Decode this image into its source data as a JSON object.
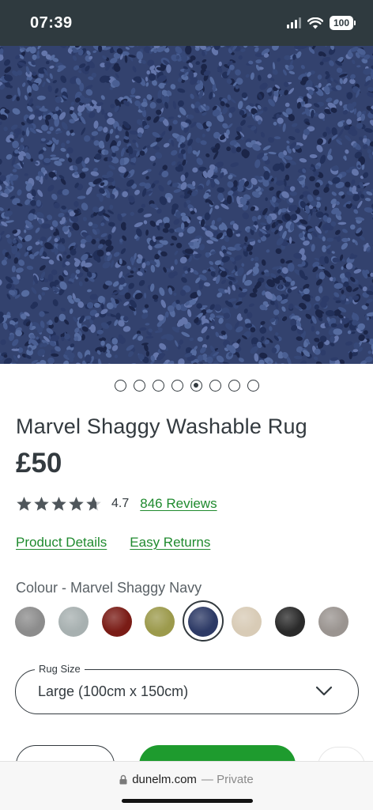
{
  "status": {
    "time": "07:39",
    "battery": "100",
    "icons": [
      "cellular-signal-icon",
      "wifi-icon",
      "battery-icon"
    ]
  },
  "gallery": {
    "image_name": "navy-shaggy-rug-closeup",
    "slides": 8,
    "active_slide": 5
  },
  "product": {
    "title": "Marvel Shaggy Washable Rug",
    "price": "£50",
    "rating": "4.7",
    "rating_stars": 4.7,
    "reviews_label": "846 Reviews",
    "links": {
      "details": "Product Details",
      "returns": "Easy Returns"
    }
  },
  "colour": {
    "label": "Colour - Marvel Shaggy Navy",
    "selected_index": 4,
    "swatches": [
      {
        "name": "grey",
        "color": "#8c8c8c"
      },
      {
        "name": "duck-egg",
        "color": "#a7b0b0"
      },
      {
        "name": "red",
        "color": "#7a1c16"
      },
      {
        "name": "green",
        "color": "#9c9a4c"
      },
      {
        "name": "navy",
        "color": "#2d3a66"
      },
      {
        "name": "cream",
        "color": "#d8cbb6"
      },
      {
        "name": "charcoal",
        "color": "#2a2a2a"
      },
      {
        "name": "silver",
        "color": "#9a9490"
      }
    ]
  },
  "size": {
    "legend": "Rug Size",
    "value": "Large (100cm x 150cm)"
  },
  "browser": {
    "domain": "dunelm.com",
    "mode": "— Private"
  },
  "colors": {
    "accent_green": "#1e9b2e",
    "link_green": "#1f8a2e",
    "text_dark": "#333a3f",
    "status_bar": "#2f3a3f"
  }
}
